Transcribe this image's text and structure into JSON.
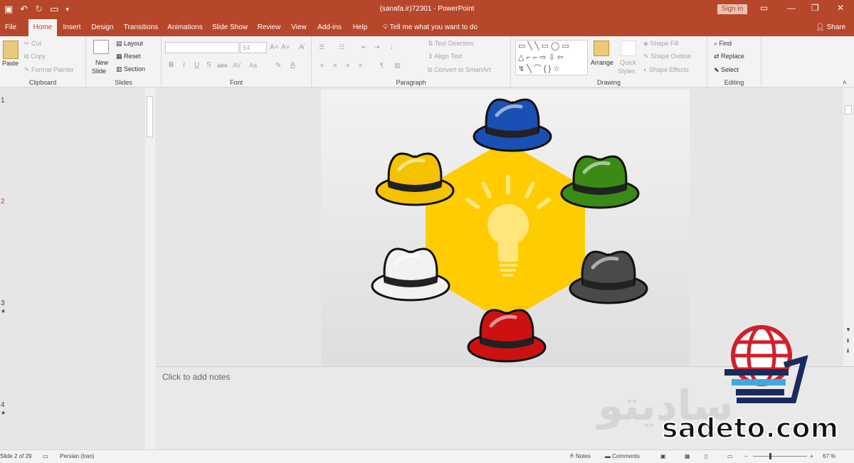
{
  "window": {
    "title": "(sanafa.ir)72301  -  PowerPoint",
    "signin": "Sign in"
  },
  "tabs": [
    "File",
    "Home",
    "Insert",
    "Design",
    "Transitions",
    "Animations",
    "Slide Show",
    "Review",
    "View",
    "Add-ins",
    "Help"
  ],
  "tellme": "Tell me what you want to do",
  "share": "Share",
  "ribbon": {
    "clipboard": {
      "paste": "Paste",
      "cut": "Cut",
      "copy": "Copy",
      "format_painter": "Format Painter",
      "label": "Clipboard"
    },
    "slides": {
      "new_slide": "New",
      "new_slide2": "Slide",
      "layout": "Layout",
      "reset": "Reset",
      "section": "Section",
      "label": "Slides"
    },
    "font": {
      "size": "54",
      "label": "Font"
    },
    "paragraph": {
      "text_direction": "Text Direction",
      "align_text": "Align Text",
      "convert": "Convert to SmartArt",
      "label": "Paragraph"
    },
    "drawing": {
      "arrange": "Arrange",
      "quick": "Quick",
      "styles": "Styles",
      "shape_fill": "Shape Fill",
      "shape_outline": "Shape Outline",
      "shape_effects": "Shape Effects",
      "label": "Drawing"
    },
    "editing": {
      "find": "Find",
      "replace": "Replace",
      "select": "Select",
      "label": "Editing"
    }
  },
  "thumbnails": [
    {
      "num": "1",
      "star": ""
    },
    {
      "num": "2",
      "star": ""
    },
    {
      "num": "3",
      "star": "★"
    },
    {
      "num": "4",
      "star": "★"
    }
  ],
  "slide": {
    "hats": [
      "blue-hat",
      "green-hat",
      "black-hat",
      "red-hat",
      "white-hat",
      "yellow-hat"
    ],
    "center": "lightbulb"
  },
  "notes_placeholder": "Click to add notes",
  "status": {
    "slide": "Slide 2 of 29",
    "language": "Persian (Iran)",
    "notes": "Notes",
    "comments": "Comments",
    "zoom": "67 %"
  },
  "watermark": {
    "text": "sadeto.com"
  },
  "colors": {
    "accent": "#b7472a",
    "blue": "#1a4fb3",
    "green": "#3a8a16",
    "black": "#4a4a4a",
    "red": "#cc1111",
    "white": "#f2f2f2",
    "yellow": "#f3c300",
    "hexagon": "#ffcc00"
  }
}
